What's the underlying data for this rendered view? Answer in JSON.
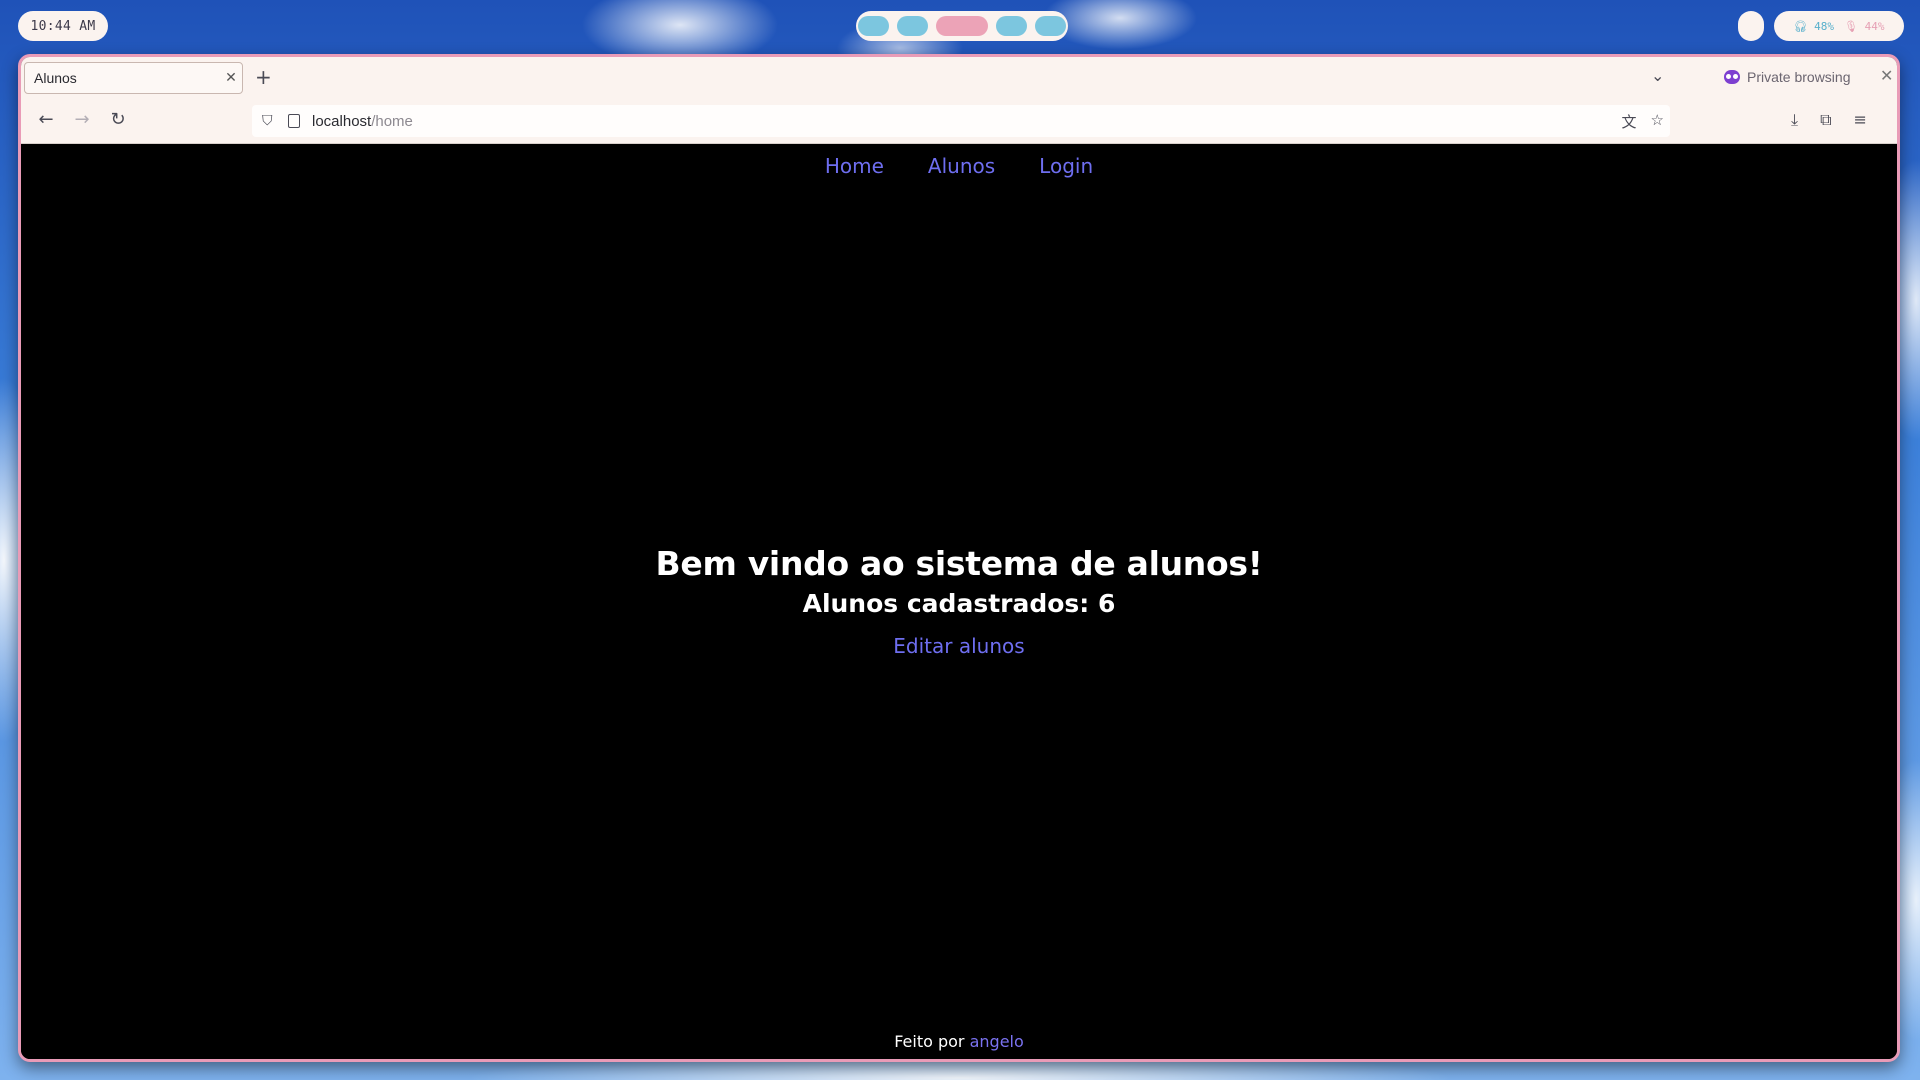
{
  "system": {
    "clock": "10:44 AM",
    "headphones_level": "48%",
    "mic_level": "44%",
    "workspace_count": 5,
    "active_workspace": 3
  },
  "browser": {
    "tab_title": "Alunos",
    "private_label": "Private browsing",
    "url_host": "localhost",
    "url_path": "/home"
  },
  "site": {
    "nav": [
      "Home",
      "Alunos",
      "Login"
    ],
    "heading": "Bem vindo ao sistema de alunos!",
    "subheading": "Alunos cadastrados: 6",
    "edit_link": "Editar alunos",
    "footer_prefix": "Feito por",
    "footer_author": "angelo"
  },
  "colors": {
    "link": "#6e6ef0",
    "window_border": "#e99bb7",
    "page_background": "#000000"
  }
}
